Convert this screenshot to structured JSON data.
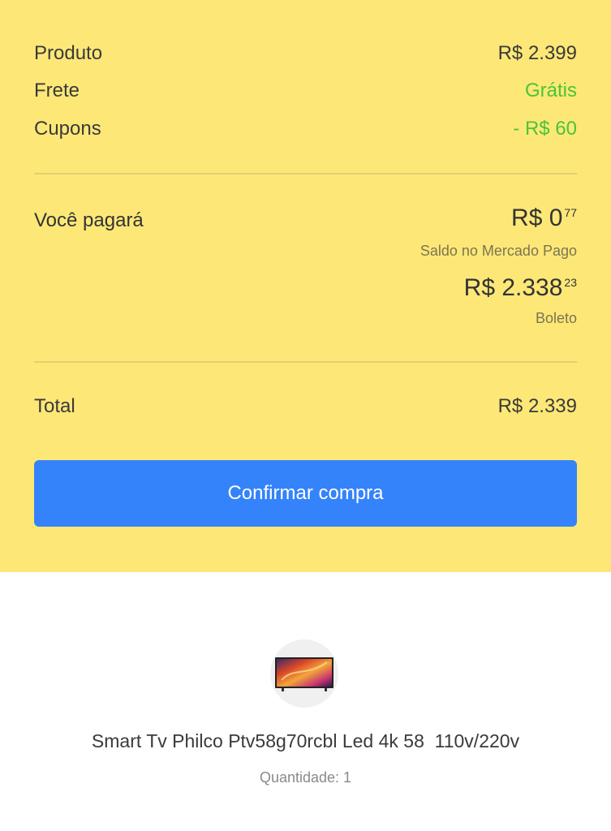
{
  "summary": {
    "lines": [
      {
        "label": "Produto",
        "value": "R$ 2.399"
      },
      {
        "label": "Frete",
        "value": "Grátis"
      },
      {
        "label": "Cupons",
        "value": "- R$ 60"
      }
    ],
    "pay": {
      "label": "Você pagará",
      "payments": [
        {
          "int": "R$ 0",
          "cents": "77",
          "method": "Saldo no Mercado Pago"
        },
        {
          "int": "R$ 2.338",
          "cents": "23",
          "method": "Boleto"
        }
      ]
    },
    "total": {
      "label": "Total",
      "value": "R$ 2.339"
    },
    "confirm_label": "Confirmar compra"
  },
  "product": {
    "title": "Smart Tv Philco Ptv58g70rcbl Led 4k 58  110v/220v",
    "quantity": "Quantidade: 1",
    "image_icon": "tv-product-icon"
  },
  "colors": {
    "summary_bg": "#fde877",
    "accent": "#3483fa",
    "green": "#4cc33a"
  }
}
